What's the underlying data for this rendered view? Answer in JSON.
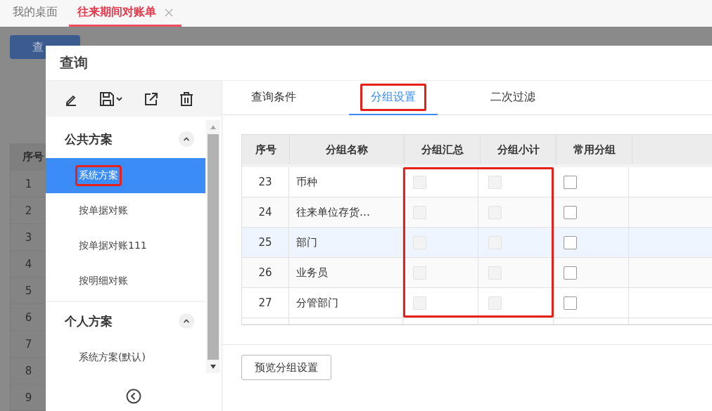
{
  "tabs": [
    {
      "label": "我的桌面",
      "selected": false,
      "closable": false
    },
    {
      "label": "往来期间对账单",
      "selected": true,
      "closable": true
    }
  ],
  "background": {
    "button": "查",
    "table": {
      "header": "序号",
      "rows": [
        "1",
        "2",
        "3",
        "4",
        "5",
        "6",
        "7",
        "8",
        "9"
      ]
    }
  },
  "dialog": {
    "title": "查询",
    "sidebar": {
      "groups": [
        {
          "title": "公共方案",
          "expanded": true,
          "items": [
            {
              "label": "系统方案",
              "selected": true,
              "highlighted": true
            },
            {
              "label": "按单据对账",
              "selected": false,
              "highlighted": false
            },
            {
              "label": "按单据对账111",
              "selected": false,
              "highlighted": false
            },
            {
              "label": "按明细对账",
              "selected": false,
              "highlighted": false
            }
          ]
        },
        {
          "title": "个人方案",
          "expanded": true,
          "items": [
            {
              "label": "系统方案(默认)",
              "selected": false,
              "highlighted": false
            }
          ]
        }
      ]
    },
    "tabs": [
      {
        "label": "查询条件",
        "selected": false,
        "highlighted": false
      },
      {
        "label": "分组设置",
        "selected": true,
        "highlighted": true
      },
      {
        "label": "二次过滤",
        "selected": false,
        "highlighted": false
      }
    ],
    "table": {
      "columns": [
        {
          "label": "序号",
          "highlighted": false
        },
        {
          "label": "分组名称",
          "highlighted": false
        },
        {
          "label": "分组汇总",
          "highlighted": true
        },
        {
          "label": "分组小计",
          "highlighted": true
        },
        {
          "label": "常用分组",
          "highlighted": false
        }
      ],
      "rows": [
        {
          "index": "23",
          "name": "币种",
          "selected": false,
          "checks": [
            {
              "kind": "disabled",
              "checked": false
            },
            {
              "kind": "disabled",
              "checked": false
            },
            {
              "kind": "normal",
              "checked": false
            }
          ]
        },
        {
          "index": "24",
          "name": "往来单位存货…",
          "selected": false,
          "checks": [
            {
              "kind": "disabled",
              "checked": false
            },
            {
              "kind": "disabled",
              "checked": false
            },
            {
              "kind": "normal",
              "checked": false
            }
          ]
        },
        {
          "index": "25",
          "name": "部门",
          "selected": true,
          "checks": [
            {
              "kind": "disabled",
              "checked": false
            },
            {
              "kind": "disabled",
              "checked": false
            },
            {
              "kind": "normal",
              "checked": false
            }
          ]
        },
        {
          "index": "26",
          "name": "业务员",
          "selected": false,
          "checks": [
            {
              "kind": "disabled",
              "checked": false
            },
            {
              "kind": "disabled",
              "checked": false
            },
            {
              "kind": "normal",
              "checked": false
            }
          ]
        },
        {
          "index": "27",
          "name": "分管部门",
          "selected": false,
          "checks": [
            {
              "kind": "disabled",
              "checked": false
            },
            {
              "kind": "disabled",
              "checked": false
            },
            {
              "kind": "normal",
              "checked": false
            }
          ]
        }
      ]
    },
    "preview_button": "预览分组设置"
  }
}
